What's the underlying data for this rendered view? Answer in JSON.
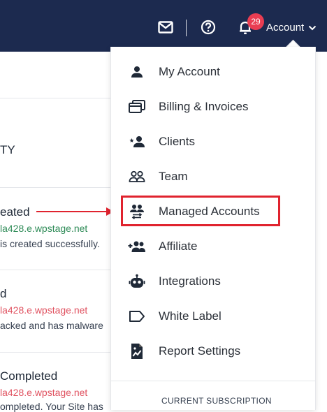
{
  "header": {
    "notification_count": "29",
    "account_label": "Account",
    "icons": [
      "mail-icon",
      "help-icon",
      "bell-icon",
      "chevron-down-icon"
    ]
  },
  "background": {
    "section_heading": "TY",
    "activities": [
      {
        "title": "eated",
        "site": "la428.e.wpstage.net",
        "desc": "is created successfully."
      },
      {
        "title": "d",
        "site": "la428.e.wpstage.net",
        "desc": "acked and has malware"
      },
      {
        "title": "Completed",
        "site": "la428.e.wpstage.net",
        "desc": "ompleted. Your Site has"
      }
    ]
  },
  "menu": {
    "items": [
      {
        "label": "My Account",
        "icon": "person-icon"
      },
      {
        "label": "Billing & Invoices",
        "icon": "billing-icon"
      },
      {
        "label": "Clients",
        "icon": "clients-icon"
      },
      {
        "label": "Team",
        "icon": "team-icon"
      },
      {
        "label": "Managed Accounts",
        "icon": "managed-accounts-icon"
      },
      {
        "label": "Affiliate",
        "icon": "affiliate-icon"
      },
      {
        "label": "Integrations",
        "icon": "robot-icon"
      },
      {
        "label": "White Label",
        "icon": "label-icon"
      },
      {
        "label": "Report Settings",
        "icon": "report-icon"
      }
    ],
    "subscription_label": "CURRENT SUBSCRIPTION"
  },
  "colors": {
    "topbar": "#1c2a4f",
    "badge": "#ea3d52",
    "highlight": "#e0232e",
    "green_link": "#2e8b57",
    "red_link": "#e05260"
  }
}
